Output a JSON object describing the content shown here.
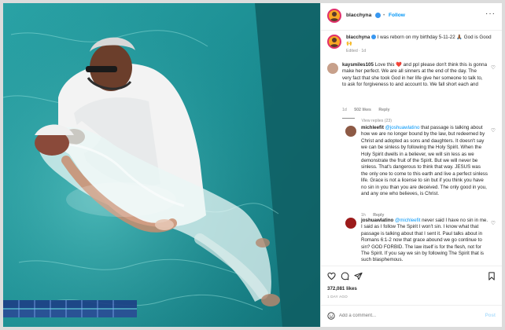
{
  "post": {
    "username": "blacchyna",
    "follow_label": "Follow",
    "more_icon": "more-dots-icon",
    "verified_icon": "verified-badge-icon",
    "caption_user": "blacchyna",
    "caption_text": "I was reborn on my birthday 5-11-22 🙏🏾 God is Good 🙌",
    "caption_meta": "Edited · 1d",
    "likes": "372,081 likes",
    "time_ago": "1 DAY AGO",
    "add_comment_placeholder": "Add a comment...",
    "post_label": "Post"
  },
  "comments": [
    {
      "user": "kaysmiles105",
      "text": "Love this ❤️ and ppl please don't think this is gonna make her perfect. We are all sinners at the end of the day. The very fact that she took God in her life give her someone to talk to, to ask for forgiveness to and account to. We fall short each and",
      "time": "1d",
      "likes": "502 likes",
      "reply": "Reply",
      "view_replies": "View replies (23)"
    },
    {
      "user": "michleefit",
      "mention": "@joshuawlatino",
      "text": "that passage is talking about how we are no longer bound by the law, but redeemed by Christ and adopted as sons and daughters. It doesn't say we can be sinless by following the Holy Spirit. When the Holy Spirit dwells in a believer, we will sin less as we demonstrate the fruit of the Spirit. But we will never be sinless. That's dangerous to think that way. JESUS was the only one to come to this earth and live a perfect sinless life. Grace is not a license to sin but if you think you have no sin in you than you are deceived. The only good in you, and any one who believes, is Christ.",
      "time": "1h",
      "reply": "Reply"
    },
    {
      "user": "joshuawlatino",
      "mention": "@michleefit",
      "text": "never said I have no sin in me. I said as I follow The Spirit I won't sin. I know what that passage is talking about that I sent it. Paul talks about in Romans 6:1-2 now that grace abound we go continue to sin? GOD FORBID. The law itself is for the flesh, not for The Spirit. If you say we sin by following The Spirit that is such blasphemous.",
      "time": "",
      "reply": ""
    }
  ],
  "actions": {
    "like_icon": "heart-icon",
    "comment_icon": "comment-icon",
    "share_icon": "share-icon",
    "save_icon": "bookmark-icon",
    "emoji_icon": "smiley-icon"
  },
  "colors": {
    "pool_water": "#1f8f93",
    "link_blue": "#0095f6",
    "text_dark": "#262626",
    "muted_gray": "#8e8e8e"
  }
}
